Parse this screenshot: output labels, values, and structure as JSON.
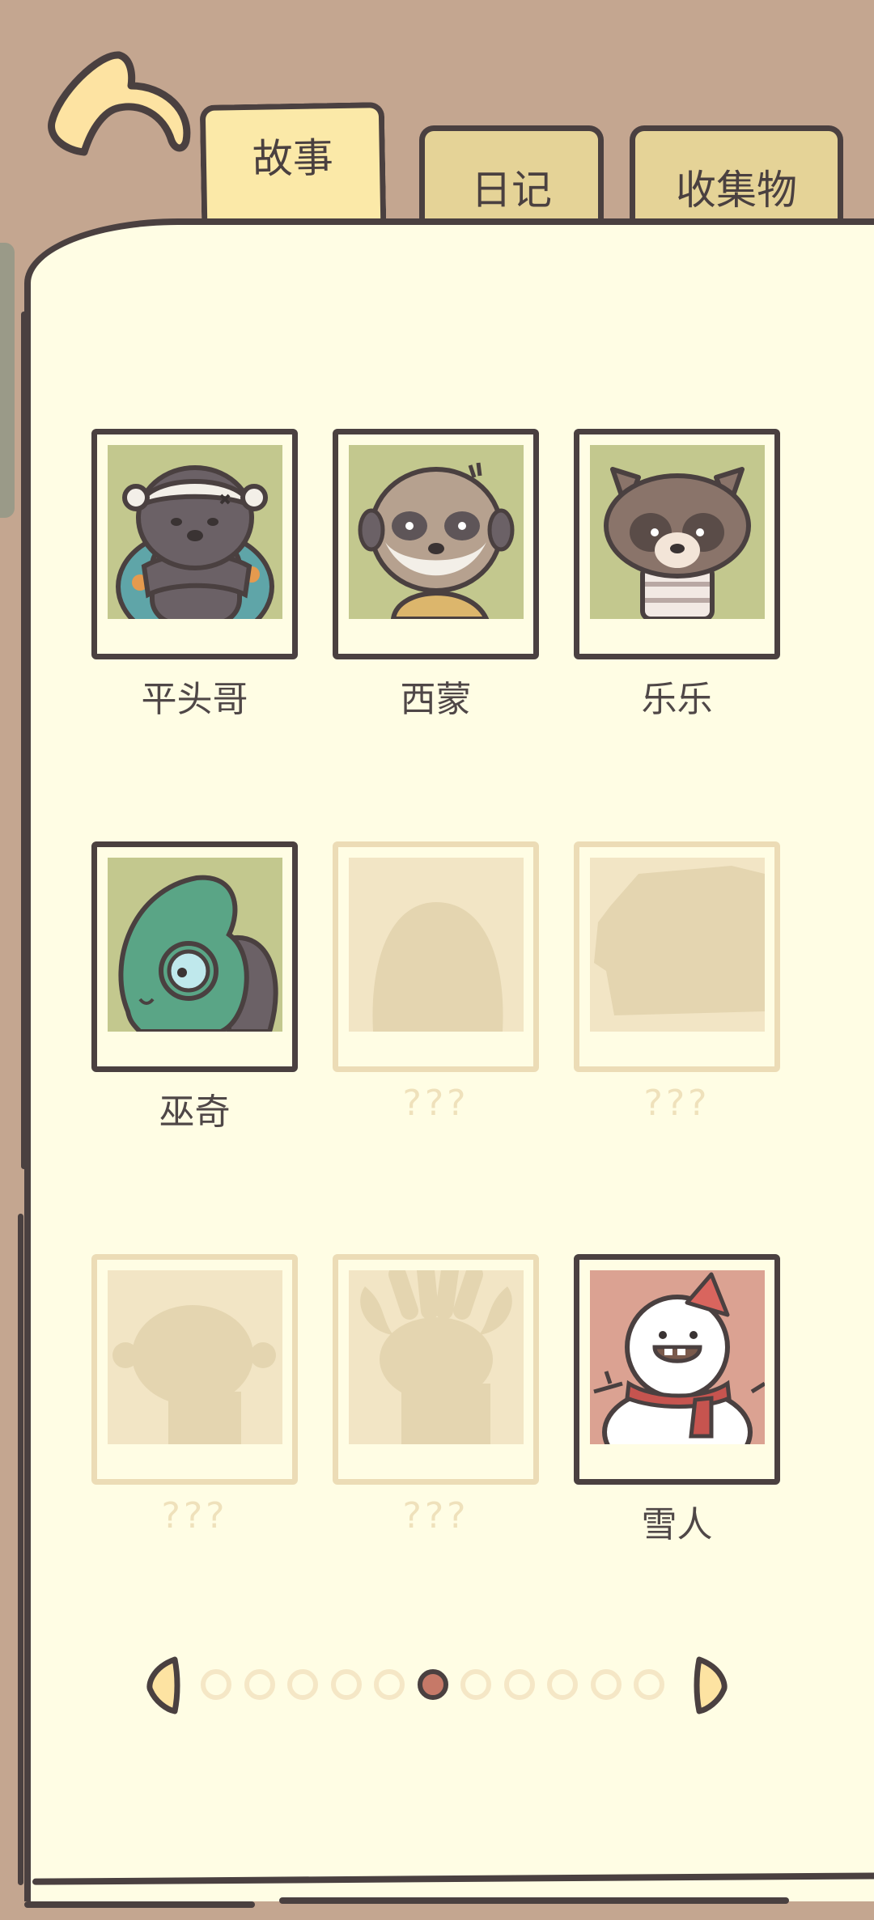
{
  "tabs": [
    {
      "label": "故事",
      "active": true
    },
    {
      "label": "日记",
      "active": false
    },
    {
      "label": "收集物",
      "active": false
    }
  ],
  "characters": [
    {
      "name": "平头哥",
      "unlocked": true,
      "icon": "honey-badger-portrait",
      "bg": "#c3c88e"
    },
    {
      "name": "西蒙",
      "unlocked": true,
      "icon": "meerkat-portrait",
      "bg": "#c3c88e"
    },
    {
      "name": "乐乐",
      "unlocked": true,
      "icon": "raccoon-dog-portrait",
      "bg": "#c3c88e"
    },
    {
      "name": "巫奇",
      "unlocked": true,
      "icon": "chameleon-portrait",
      "bg": "#c3c88e"
    },
    {
      "name": "???",
      "unlocked": false,
      "icon": "locked-egg-silhouette"
    },
    {
      "name": "???",
      "unlocked": false,
      "icon": "locked-box-silhouette"
    },
    {
      "name": "???",
      "unlocked": false,
      "icon": "locked-animal-silhouette"
    },
    {
      "name": "???",
      "unlocked": false,
      "icon": "locked-moose-silhouette"
    },
    {
      "name": "雪人",
      "unlocked": true,
      "icon": "snowman-portrait",
      "bg": "#dba292"
    }
  ],
  "pagination": {
    "total_pages": 11,
    "current_page": 6
  },
  "colors": {
    "outline": "#4a4040",
    "page_bg": "#fffde4",
    "top_bg": "#c4a690",
    "active_dot": "#c67968"
  }
}
